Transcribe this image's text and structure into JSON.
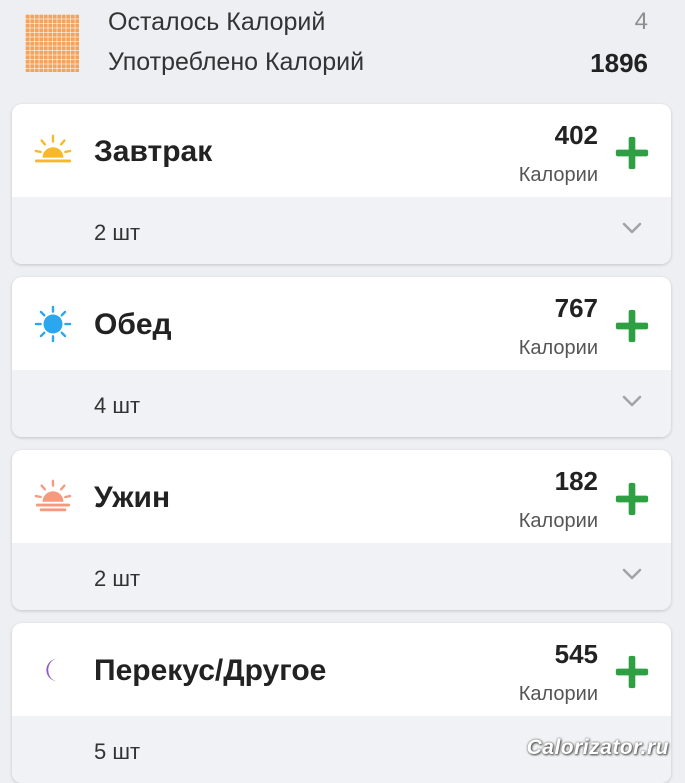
{
  "summary": {
    "remaining_label": "Осталось Калорий",
    "remaining_value": "4",
    "consumed_label": "Употреблено Калорий",
    "consumed_value": "1896",
    "icon": "calorie-grid-icon"
  },
  "meals": [
    {
      "title": "Завтрак",
      "calories": "402",
      "calories_label": "Калории",
      "count": "2 шт",
      "icon": "sunrise-icon"
    },
    {
      "title": "Обед",
      "calories": "767",
      "calories_label": "Калории",
      "count": "4 шт",
      "icon": "sun-icon"
    },
    {
      "title": "Ужин",
      "calories": "182",
      "calories_label": "Калории",
      "count": "2 шт",
      "icon": "sunset-icon"
    },
    {
      "title": "Перекус/Другое",
      "calories": "545",
      "calories_label": "Калории",
      "count": "5 шт",
      "icon": "moon-icon"
    }
  ],
  "watermark": "Calorizator.ru",
  "colors": {
    "accent_green": "#2ea043",
    "sunrise": "#f5b92c",
    "sun": "#2aa7ee",
    "sunset": "#f49a7e",
    "moon": "#8e5cc9",
    "grid": "#f2a35e"
  }
}
